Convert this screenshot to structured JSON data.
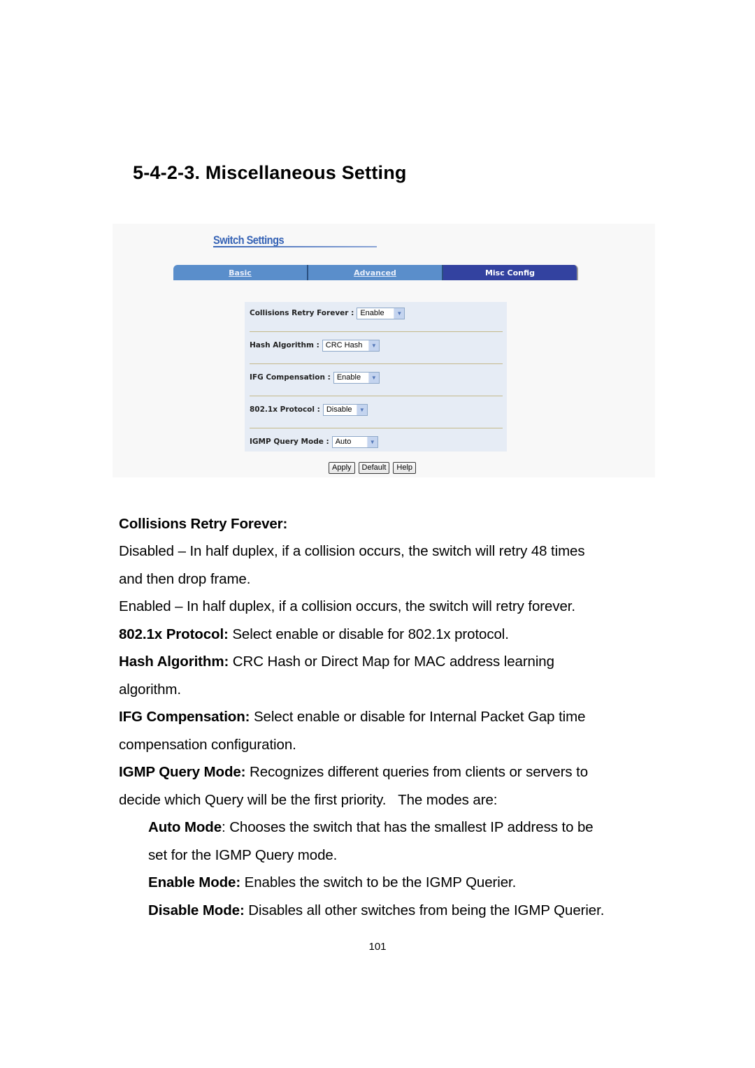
{
  "section_heading": "5-4-2-3. Miscellaneous Setting",
  "screenshot": {
    "title": "Switch Settings",
    "tabs": [
      {
        "label": "Basic",
        "active": false
      },
      {
        "label": "Advanced",
        "active": false
      },
      {
        "label": "Misc Config",
        "active": true
      }
    ],
    "fields": [
      {
        "label": "Collisions Retry Forever :",
        "value": "Enable"
      },
      {
        "label": "Hash Algorithm :",
        "value": "CRC Hash"
      },
      {
        "label": "IFG Compensation :",
        "value": "Enable"
      },
      {
        "label": "802.1x Protocol :",
        "value": "Disable"
      },
      {
        "label": "IGMP Query Mode :",
        "value": "Auto"
      }
    ],
    "buttons": {
      "apply": "Apply",
      "default": "Default",
      "help": "Help"
    },
    "dropdown_arrow_icon": "chevron-down"
  },
  "body": {
    "collisions_heading": "Collisions Retry Forever:",
    "collisions_disabled_1": "Disabled – In half duplex, if a collision occurs, the switch will retry 48 times",
    "collisions_disabled_2": "and then drop frame.",
    "collisions_enabled": "Enabled – In half duplex, if a collision occurs, the switch will retry forever.",
    "dot1x_term": "802.1x Protocol:",
    "dot1x_desc": " Select enable or disable for 802.1x protocol.",
    "hash_term": "Hash Algorithm:",
    "hash_desc_1": " CRC Hash or Direct Map for MAC address learning",
    "hash_desc_2": "algorithm.",
    "ifg_term": "IFG Compensation:",
    "ifg_desc_1": " Select enable or disable for Internal Packet Gap time",
    "ifg_desc_2": "compensation configuration.",
    "igmp_term": "IGMP Query Mode:",
    "igmp_desc_1": " Recognizes different queries from clients or servers to",
    "igmp_desc_2": "decide which Query will be the first priority.   The modes are:",
    "auto_term": "Auto Mode",
    "auto_desc_1": ": Chooses the switch that has the smallest IP address to be",
    "auto_desc_2": "set for the IGMP Query mode.",
    "enable_term": "Enable Mode:",
    "enable_desc": " Enables the switch to be the IGMP Querier.",
    "disable_term": "Disable Mode:",
    "disable_desc": " Disables all other switches from being the IGMP Querier."
  },
  "page_number": "101"
}
